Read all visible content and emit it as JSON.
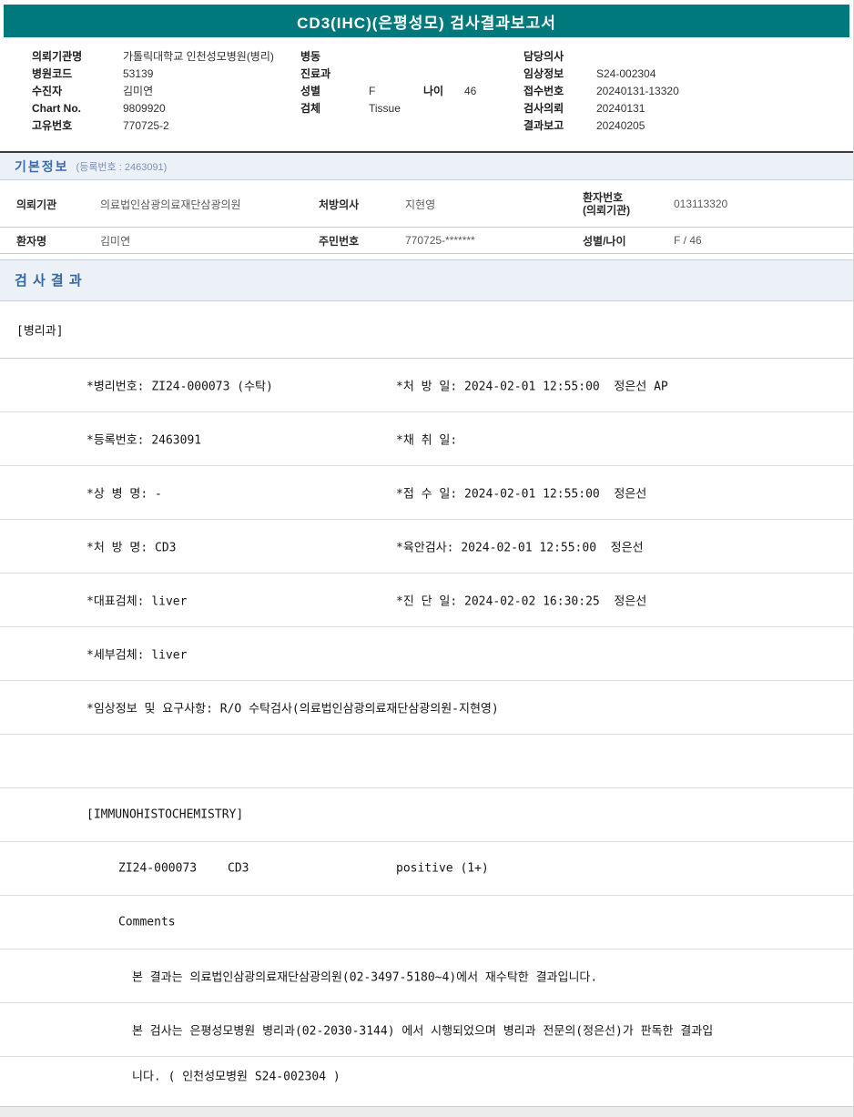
{
  "title": "CD3(IHC)(은평성모) 검사결과보고서",
  "header": {
    "left": [
      {
        "label": "의뢰기관명",
        "value": "가톨릭대학교 인천성모병원(병리)"
      },
      {
        "label": "병원코드",
        "value": "53139"
      },
      {
        "label": "수진자",
        "value": "김미연"
      },
      {
        "label": "Chart No.",
        "value": "9809920"
      },
      {
        "label": "고유번호",
        "value": "770725-2"
      }
    ],
    "middle": {
      "ward_label": "병동",
      "ward_value": "",
      "dept_label": "진료과",
      "dept_value": "",
      "sex_label": "성별",
      "sex_value": "F",
      "age_label": "나이",
      "age_value": "46",
      "specimen_label": "검체",
      "specimen_value": "Tissue"
    },
    "right": [
      {
        "label": "담당의사",
        "value": ""
      },
      {
        "label": "임상정보",
        "value": "S24-002304"
      },
      {
        "label": "접수번호",
        "value": "20240131-13320"
      },
      {
        "label": "검사의뢰",
        "value": "20240131"
      },
      {
        "label": "결과보고",
        "value": "20240205"
      }
    ]
  },
  "basic_info": {
    "title": "기본정보",
    "subtitle": "(등록번호 : 2463091)",
    "row1": {
      "label1": "의뢰기관",
      "value1": "의료법인삼광의료재단삼광의원",
      "label2": "처방의사",
      "value2": "지현영",
      "label3_line1": "환자번호",
      "label3_line2": "(의뢰기관)",
      "value3": "013113320"
    },
    "row2": {
      "label1": "환자명",
      "value1": "김미연",
      "label2": "주민번호",
      "value2": "770725-*******",
      "label3": "성별/나이",
      "value3": "F / 46"
    }
  },
  "results": {
    "title": "검 사 결 과",
    "department": "[병리과]",
    "rows": [
      {
        "left": "*병리번호: ZI24-000073 (수탁)",
        "right": "*처 방 일: 2024-02-01 12:55:00  정은선 AP"
      },
      {
        "left": "*등록번호: 2463091",
        "right": "*채 취 일:"
      },
      {
        "left": "*상 병 명: -",
        "right": "*접 수 일: 2024-02-01 12:55:00  정은선"
      },
      {
        "left": "*처 방 명: CD3",
        "right": "*육안검사: 2024-02-01 12:55:00  정은선"
      },
      {
        "left": "*대표검체: liver",
        "right": "*진 단 일: 2024-02-02 16:30:25  정은선"
      },
      {
        "left": "*세부검체: liver",
        "right": ""
      },
      {
        "left": "*임상정보 및 요구사항: R/O 수탁검사(의료법인삼광의료재단삼광의원-지현영)",
        "right": ""
      }
    ],
    "ihc_header": "[IMMUNOHISTOCHEMISTRY]",
    "ihc_result": {
      "specimen_no": "ZI24-000073",
      "test_name": "CD3",
      "result": "positive (1+)"
    },
    "comments_label": "Comments",
    "comment_lines": [
      "본 결과는 의료법인삼광의료재단삼광의원(02-3497-5180~4)에서 재수탁한 결과입니다.",
      "본 검사는 은평성모병원 병리과(02-2030-3144) 에서 시행되었으며 병리과 전문의(정은선)가 판독한 결과입",
      "니다. ( 인천성모병원 S24-002304 )"
    ]
  }
}
